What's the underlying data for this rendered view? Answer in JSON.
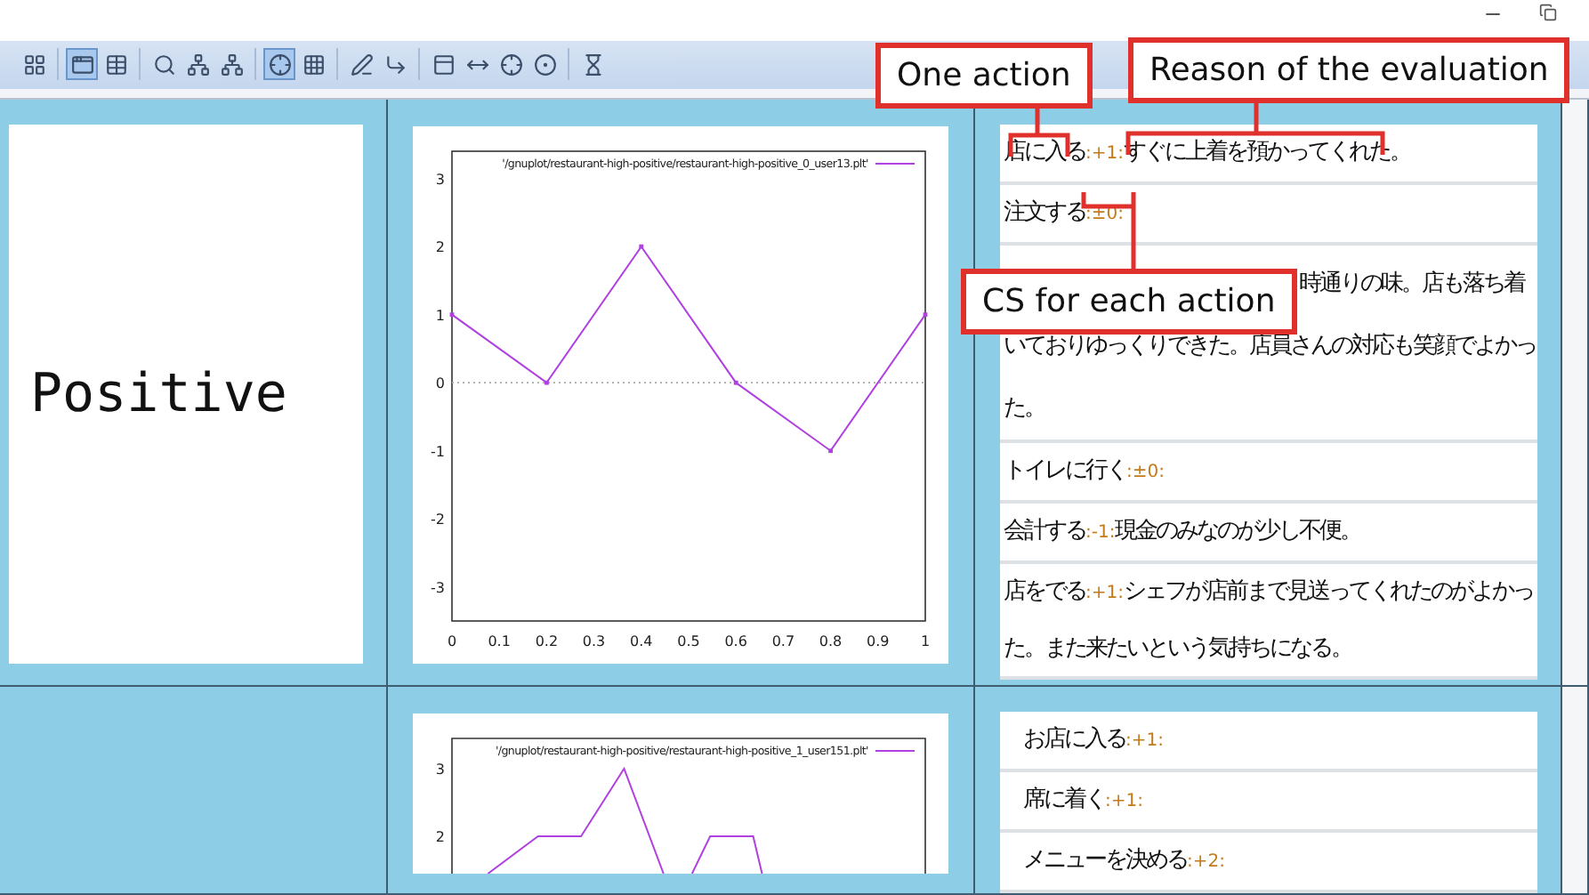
{
  "toolbar": {
    "groups": [
      {
        "buttons": [
          {
            "pressed": false
          }
        ]
      },
      {
        "buttons": [
          {
            "pressed": true
          },
          {
            "pressed": false
          }
        ]
      },
      {
        "buttons": [
          {
            "pressed": false
          },
          {
            "pressed": false
          },
          {
            "pressed": false
          }
        ]
      },
      {
        "buttons": [
          {
            "pressed": true
          },
          {
            "pressed": false
          }
        ]
      },
      {
        "buttons": [
          {
            "pressed": false
          },
          {
            "pressed": false
          }
        ]
      },
      {
        "buttons": [
          {
            "pressed": false
          },
          {
            "pressed": false
          },
          {
            "pressed": false
          },
          {
            "pressed": false
          }
        ]
      },
      {
        "buttons": [
          {
            "pressed": false
          }
        ]
      }
    ]
  },
  "annotations": [
    {
      "label": "One action"
    },
    {
      "label": "Reason of the evaluation"
    },
    {
      "label": "CS for each action"
    }
  ],
  "rows": [
    {
      "label": "Positive",
      "plot": {
        "chart_data": {
          "type": "line",
          "x": [
            0,
            0.2,
            0.4,
            0.6,
            0.8,
            1
          ],
          "series": [
            {
              "name": "'/gnuplot/restaurant-high-positive/restaurant-high-positive_0_user13.plt'",
              "color": "#b040e0",
              "marker": "square",
              "values": [
                1,
                0,
                2,
                0,
                -1,
                1
              ]
            }
          ],
          "xlim": [
            0,
            1
          ],
          "ylim": [
            -3.5,
            3.4
          ],
          "xticks": [
            0,
            0.1,
            0.2,
            0.3,
            0.4,
            0.5,
            0.6,
            0.7,
            0.8,
            0.9,
            1
          ],
          "yticks": [
            -3,
            -2,
            -1,
            0,
            1,
            2,
            3
          ]
        }
      },
      "evaluations": [
        {
          "kind": "full",
          "action": "店に入る",
          "score": ":+1:",
          "reason": "すぐに上着を預かってくれた。"
        },
        {
          "kind": "full",
          "action": "注文する",
          "score": ":±0:"
        },
        {
          "kind": "partial",
          "reason": "時通りの味。店も落ち着いておりゆっくりできた。店員さんの対応も笑顔でよかった。"
        },
        {
          "kind": "full",
          "action": "トイレに行く",
          "score": ":±0:"
        },
        {
          "kind": "full",
          "action": "会計する",
          "score": ":-1:",
          "reason": "現金のみなのが少し不便。"
        },
        {
          "kind": "full",
          "action": "店をでる",
          "score": ":+1:",
          "reason": "シェフが店前まで見送ってくれたのがよかった。また来たいという気持ちになる。"
        }
      ]
    },
    {
      "plot": {
        "legend": "'/gnuplot/restaurant-high-positive/restaurant-high-positive_1_user151.plt'",
        "ytick_labels": [
          "3",
          "2"
        ]
      },
      "evaluations": [
        {
          "kind": "indented",
          "action": "お店に入る",
          "score": ":+1:"
        },
        {
          "kind": "indented",
          "action": "席に着く",
          "score": ":+1:"
        },
        {
          "kind": "indented",
          "action": "メニューを決める",
          "score": ":+2:"
        }
      ]
    }
  ]
}
